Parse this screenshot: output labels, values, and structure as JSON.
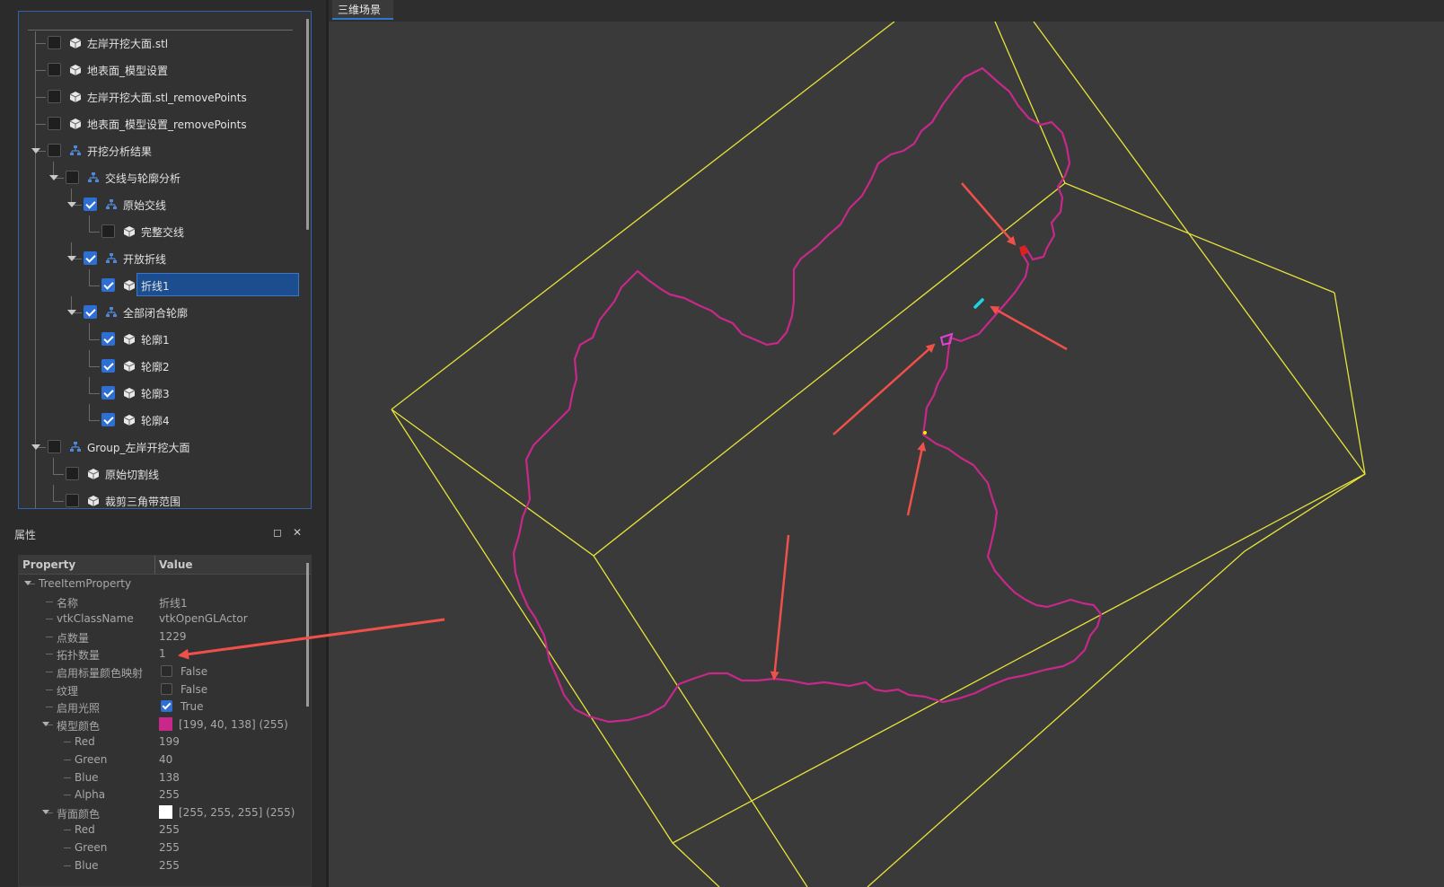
{
  "tree": {
    "items": [
      {
        "label": "左岸开挖大面.stl",
        "checked": false,
        "icon": "cube-icon",
        "depth": 0,
        "expander": false
      },
      {
        "label": "地表面_模型设置",
        "checked": false,
        "icon": "cube-icon",
        "depth": 0,
        "expander": false
      },
      {
        "label": "左岸开挖大面.stl_removePoints",
        "checked": false,
        "icon": "cube-icon",
        "depth": 0,
        "expander": false
      },
      {
        "label": "地表面_模型设置_removePoints",
        "checked": false,
        "icon": "cube-icon",
        "depth": 0,
        "expander": false
      },
      {
        "label": "开挖分析结果",
        "checked": false,
        "icon": "hierarchy-icon",
        "depth": 0,
        "expander": true
      },
      {
        "label": "交线与轮廓分析",
        "checked": false,
        "icon": "hierarchy-icon",
        "depth": 1,
        "expander": true
      },
      {
        "label": "原始交线",
        "checked": true,
        "icon": "hierarchy-icon",
        "depth": 2,
        "expander": true
      },
      {
        "label": "完整交线",
        "checked": false,
        "icon": "cube-icon",
        "depth": 3,
        "expander": false
      },
      {
        "label": "开放折线",
        "checked": true,
        "icon": "hierarchy-icon",
        "depth": 2,
        "expander": true
      },
      {
        "label": "折线1",
        "checked": true,
        "icon": "cube-icon",
        "depth": 3,
        "expander": false,
        "selected": true
      },
      {
        "label": "全部闭合轮廓",
        "checked": true,
        "icon": "hierarchy-icon",
        "depth": 2,
        "expander": true
      },
      {
        "label": "轮廓1",
        "checked": true,
        "icon": "cube-icon",
        "depth": 3,
        "expander": false
      },
      {
        "label": "轮廓2",
        "checked": true,
        "icon": "cube-icon",
        "depth": 3,
        "expander": false
      },
      {
        "label": "轮廓3",
        "checked": true,
        "icon": "cube-icon",
        "depth": 3,
        "expander": false
      },
      {
        "label": "轮廓4",
        "checked": true,
        "icon": "cube-icon",
        "depth": 3,
        "expander": false
      },
      {
        "label": "Group_左岸开挖大面",
        "checked": false,
        "icon": "hierarchy-icon",
        "depth": 0,
        "expander": true
      },
      {
        "label": "原始切割线",
        "checked": false,
        "icon": "cube-icon",
        "depth": 1,
        "expander": false
      },
      {
        "label": "裁剪三角带范围",
        "checked": false,
        "icon": "cube-icon",
        "depth": 1,
        "expander": false
      }
    ]
  },
  "props": {
    "title": "属性",
    "header_property": "Property",
    "header_value": "Value",
    "rows": [
      {
        "name": "TreeItemProperty",
        "level": 0,
        "expander": true,
        "type": "text",
        "value": ""
      },
      {
        "name": "名称",
        "level": 1,
        "type": "text",
        "value": "折线1"
      },
      {
        "name": "vtkClassName",
        "level": 1,
        "type": "text",
        "value": "vtkOpenGLActor"
      },
      {
        "name": "点数量",
        "level": 1,
        "type": "text",
        "value": "1229"
      },
      {
        "name": "拓扑数量",
        "level": 1,
        "type": "text",
        "value": "1"
      },
      {
        "name": "启用标量颜色映射",
        "level": 1,
        "type": "bool",
        "checked": false,
        "value": "False"
      },
      {
        "name": "纹理",
        "level": 1,
        "type": "bool",
        "checked": false,
        "value": "False"
      },
      {
        "name": "启用光照",
        "level": 1,
        "type": "bool",
        "checked": true,
        "value": "True"
      },
      {
        "name": "模型颜色",
        "level": 1,
        "expander": true,
        "type": "color",
        "color": "#c7288a",
        "value": "[199, 40, 138] (255)"
      },
      {
        "name": "Red",
        "level": 2,
        "type": "text",
        "value": "199"
      },
      {
        "name": "Green",
        "level": 2,
        "type": "text",
        "value": "40"
      },
      {
        "name": "Blue",
        "level": 2,
        "type": "text",
        "value": "138"
      },
      {
        "name": "Alpha",
        "level": 2,
        "type": "text",
        "value": "255"
      },
      {
        "name": "背面颜色",
        "level": 1,
        "expander": true,
        "type": "color",
        "color": "#ffffff",
        "value": "[255, 255, 255] (255)"
      },
      {
        "name": "Red",
        "level": 2,
        "type": "text",
        "value": "255"
      },
      {
        "name": "Green",
        "level": 2,
        "type": "text",
        "value": "255"
      },
      {
        "name": "Blue",
        "level": 2,
        "type": "text",
        "value": "255"
      }
    ]
  },
  "view": {
    "tab_label": "三维场景"
  },
  "colors": {
    "accent": "#2d6fd3",
    "selection": "#1c4e8f",
    "bbox_line": "#e6e33a",
    "polyline": "#c7288a",
    "annotation_arrow": "#f0504a"
  }
}
